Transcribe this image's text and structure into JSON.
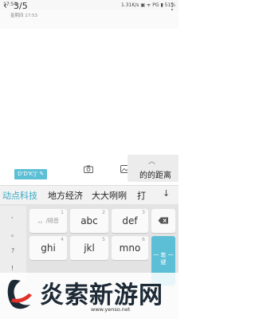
{
  "status_bar": {
    "time": "17:54",
    "right_text": "1.31K/s ▣ ᯤ PG ▮ 51%"
  },
  "header": {
    "back_icon": "chevron-left-icon",
    "page_indicator": "3/5",
    "date": "星期四 17:53",
    "menu_icon": "more-vertical-icon"
  },
  "toolbar": {
    "font_tag": "D'D'K'J'",
    "edit_glyph": "✎",
    "camera_icon": "camera-icon",
    "image_icon": "image-icon"
  },
  "candidate_popup": {
    "chevron": "︿",
    "text": "的的距离"
  },
  "candidates": {
    "items": [
      "动点科技",
      "地方经济",
      "大大咧咧",
      "打"
    ],
    "expand_icon": "↓"
  },
  "keyboard": {
    "punctuation": [
      ",",
      "。",
      "?",
      "!"
    ],
    "rows": [
      [
        {
          "num": "1",
          "label": "，。/隔音"
        },
        {
          "num": "2",
          "label": "abc"
        },
        {
          "num": "3",
          "label": "def"
        }
      ],
      [
        {
          "num": "4",
          "label": "ghi"
        },
        {
          "num": "5",
          "label": "jkl"
        },
        {
          "num": "6",
          "label": "mno"
        }
      ]
    ],
    "delete_icon": "backspace-icon",
    "clear_label": "一 笔 一 键"
  },
  "watermark": {
    "title": "炎索新游网",
    "url": "www.yenso.net"
  },
  "colors": {
    "accent": "#5dbfd6",
    "candidate_highlight": "#3aa8c4",
    "keyboard_bg": "#e3e3e3"
  }
}
